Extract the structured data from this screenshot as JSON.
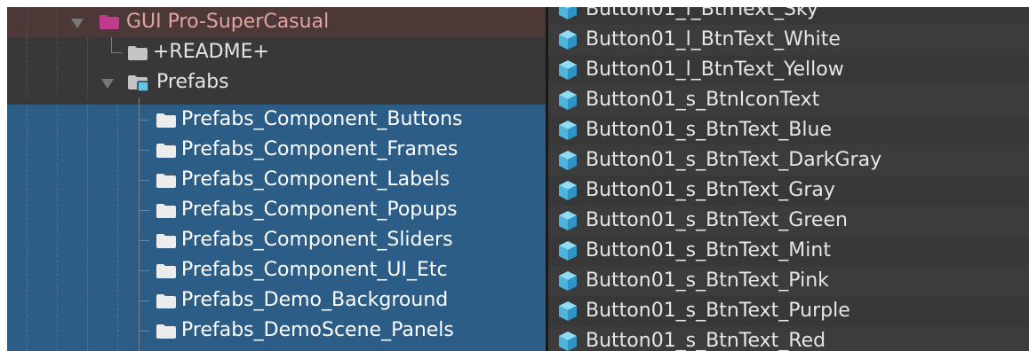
{
  "tree": {
    "items": [
      {
        "label": "GUI Pro-SuperCasual"
      },
      {
        "label": "+README+"
      },
      {
        "label": "Prefabs"
      },
      {
        "label": "Prefabs_Component_Buttons"
      },
      {
        "label": "Prefabs_Component_Frames"
      },
      {
        "label": "Prefabs_Component_Labels"
      },
      {
        "label": "Prefabs_Component_Popups"
      },
      {
        "label": "Prefabs_Component_Sliders"
      },
      {
        "label": "Prefabs_Component_UI_Etc"
      },
      {
        "label": "Prefabs_Demo_Background"
      },
      {
        "label": "Prefabs_DemoScene_Panels"
      }
    ]
  },
  "assets": {
    "items": [
      {
        "label": "Button01_l_BtnText_Sky"
      },
      {
        "label": "Button01_l_BtnText_White"
      },
      {
        "label": "Button01_l_BtnText_Yellow"
      },
      {
        "label": "Button01_s_BtnIconText"
      },
      {
        "label": "Button01_s_BtnText_Blue"
      },
      {
        "label": "Button01_s_BtnText_DarkGray"
      },
      {
        "label": "Button01_s_BtnText_Gray"
      },
      {
        "label": "Button01_s_BtnText_Green"
      },
      {
        "label": "Button01_s_BtnText_Mint"
      },
      {
        "label": "Button01_s_BtnText_Pink"
      },
      {
        "label": "Button01_s_BtnText_Purple"
      },
      {
        "label": "Button01_s_BtnText_Red"
      }
    ]
  },
  "colors": {
    "selection": "#2c5d87",
    "package_folder": "#c23a8e",
    "folder": "#c4c4c4",
    "prefab_cube": "#5ec7ee"
  },
  "icons": {
    "package": "package-folder-icon",
    "folder": "folder-icon",
    "prefabs_folder": "prefabs-folder-icon",
    "prefab": "prefab-cube-icon",
    "expand": "expand-arrow-icon"
  }
}
